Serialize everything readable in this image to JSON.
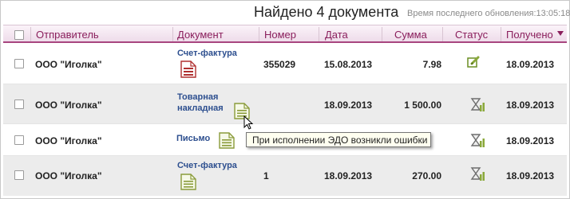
{
  "header": {
    "found_text": "Найдено 4 документа",
    "updated_text": "Время последнего обновления:13:05:18"
  },
  "columns": {
    "sender": "Отправитель",
    "document": "Документ",
    "number": "Номер",
    "date": "Дата",
    "amount": "Сумма",
    "status": "Статус",
    "received": "Получено"
  },
  "rows": [
    {
      "sender": "ООО \"Иголка\"",
      "doc_type": "Счет-фактура",
      "doc_icon": "red-document-icon",
      "number": "355029",
      "date": "15.08.2013",
      "amount": "7.98",
      "status_icon": "edit-signed-icon",
      "received": "18.09.2013"
    },
    {
      "sender": "ООО \"Иголка\"",
      "doc_type": "Товарная накладная",
      "doc_icon": "green-document-icon",
      "number": "",
      "date": "18.09.2013",
      "amount": "1 500.00",
      "status_icon": "hourglass-pending-icon",
      "received": "18.09.2013"
    },
    {
      "sender": "ООО \"Иголка\"",
      "doc_type": "Письмо",
      "doc_icon": "green-document-icon",
      "number": "",
      "date": "",
      "amount": "",
      "status_icon": "hourglass-pending-icon",
      "received": "18.09.2013"
    },
    {
      "sender": "ООО \"Иголка\"",
      "doc_type": "Счет-фактура",
      "doc_icon": "green-document-icon",
      "number": "1",
      "date": "18.09.2013",
      "amount": "270.00",
      "status_icon": "hourglass-pending-icon",
      "received": "18.09.2013"
    }
  ],
  "tooltip": {
    "text": "При исполнении ЭДО возникли ошибки"
  },
  "colors": {
    "accent": "#8a1e5c",
    "link": "#2d4f8f",
    "status_green": "#8aa83a",
    "doc_red": "#b03030"
  }
}
